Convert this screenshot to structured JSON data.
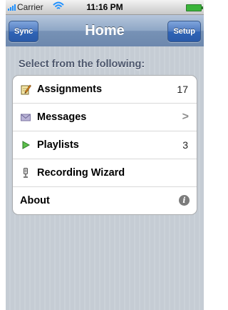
{
  "status_bar": {
    "carrier": "Carrier",
    "time": "11:16 PM",
    "signal_icon": "signal-bars-icon",
    "wifi_icon": "wifi-icon",
    "battery_icon": "battery-icon"
  },
  "nav": {
    "title": "Home",
    "left_button": "Sync",
    "right_button": "Setup"
  },
  "section": {
    "header": "Select from the following:"
  },
  "rows": [
    {
      "label": "Assignments",
      "icon": "pencil-notepad-icon",
      "count": "17"
    },
    {
      "label": "Messages",
      "icon": "envelope-icon",
      "accessory": ">"
    },
    {
      "label": "Playlists",
      "icon": "play-triangle-icon",
      "count": "3"
    },
    {
      "label": "Recording Wizard",
      "icon": "microphone-icon"
    },
    {
      "label": "About",
      "icon": "info-icon",
      "info": "i"
    }
  ],
  "colors": {
    "nav_gradient_top": "#b6c6dc",
    "nav_gradient_bottom": "#6d88ad",
    "button_blue": "#2f64b6",
    "background": "#c5ccd4",
    "section_header": "#4c566c"
  }
}
